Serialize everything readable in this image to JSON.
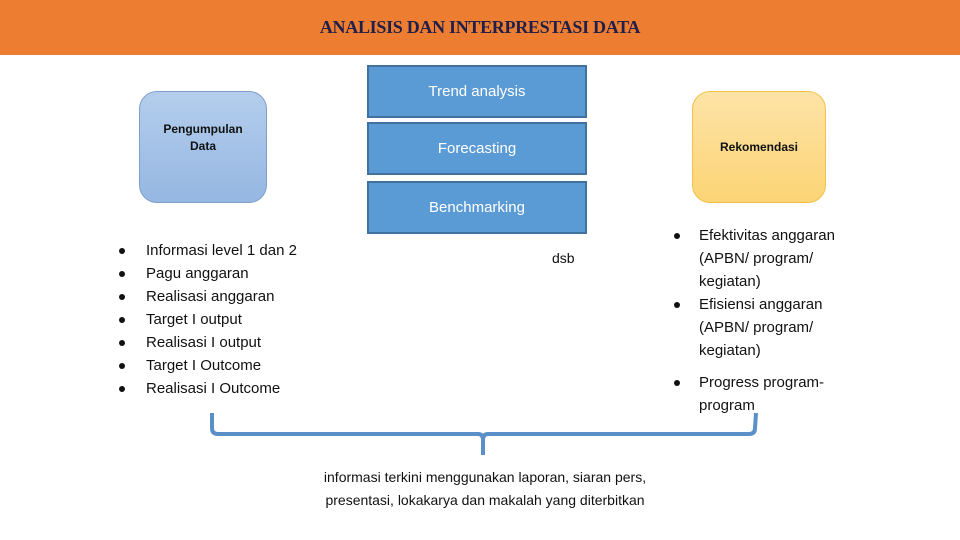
{
  "header": {
    "title": "ANALISIS DAN INTERPRESTASI DATA",
    "color": "#ed7d31"
  },
  "boxes": {
    "left": {
      "label_line1": "Pengumpulan",
      "label_line2": "Data"
    },
    "right": {
      "label": "Rekomendasi"
    }
  },
  "stack": [
    {
      "label": "Trend analysis"
    },
    {
      "label": "Forecasting"
    },
    {
      "label": "Benchmarking"
    }
  ],
  "left_list": [
    "Informasi level 1 dan 2",
    "Pagu anggaran",
    "Realisasi anggaran",
    "Target I output",
    "Realisasi I output",
    "Target I Outcome",
    "Realisasi I Outcome"
  ],
  "middle_note": "dsb",
  "right_list": [
    {
      "line1": "Efektivitas anggaran",
      "line2": "(APBN/ program/",
      "line3": "kegiatan)"
    },
    {
      "line1": "Efisiensi anggaran",
      "line2": "(APBN/ program/",
      "line3": "kegiatan)"
    },
    {
      "line1": "Progress program-",
      "line2": "program"
    }
  ],
  "bottom": {
    "line1": "informasi terkini menggunakan laporan, siaran pers,",
    "line2": "presentasi, lokakarya dan makalah yang diterbitkan"
  }
}
